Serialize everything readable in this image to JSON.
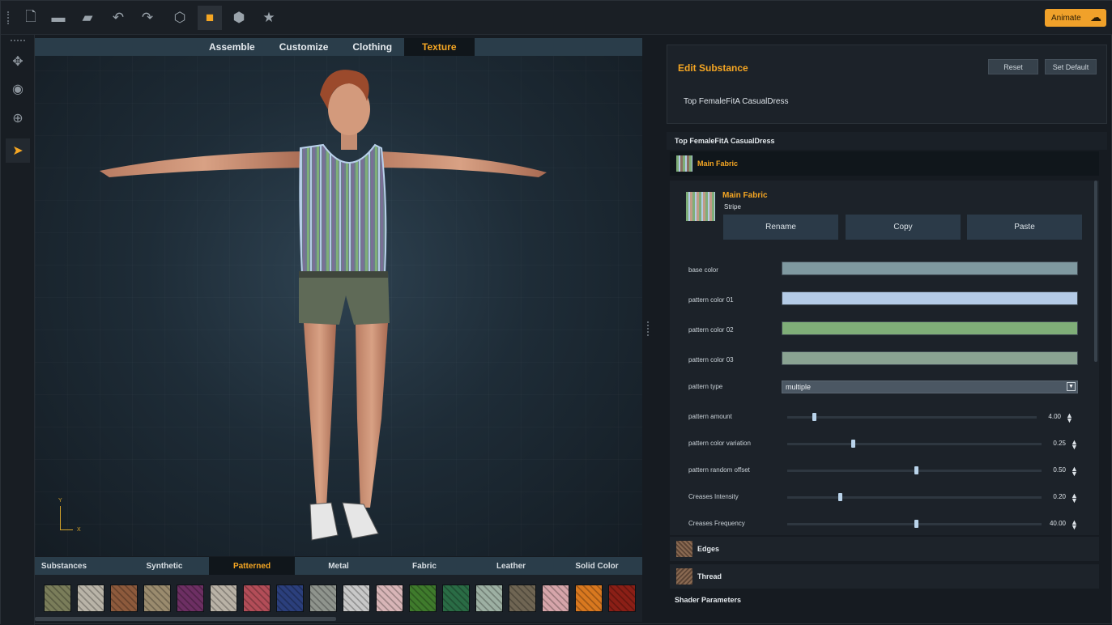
{
  "toolbar": {
    "buttons": [
      "new-file-icon",
      "open-folder-icon",
      "save-icon",
      "undo-icon",
      "redo-icon",
      "cube-wire-icon",
      "cube-solid-icon",
      "cube-shaded-icon",
      "star-icon"
    ],
    "animate_label": "Animate"
  },
  "viewport": {
    "tabs": [
      "Assemble",
      "Customize",
      "Clothing",
      "Texture"
    ],
    "active_tab": "Texture",
    "axis_y": "Y",
    "axis_x": "X"
  },
  "library": {
    "tabs": [
      "Substances",
      "Synthetic",
      "Patterned",
      "Metal",
      "Fabric",
      "Leather",
      "Solid Color"
    ],
    "active_tab": "Patterned",
    "swatch_colors": [
      "#7a7d5a",
      "#b9b4a8",
      "#8d5a3c",
      "#9a8b6e",
      "#6d2f63",
      "#b9b2a6",
      "#b34d58",
      "#2b3f7c",
      "#8f948d",
      "#c8c8c8",
      "#d8b5b7",
      "#3f7b2c",
      "#2a6c45",
      "#9db0a3",
      "#6f6553",
      "#d6a5aa",
      "#d9781f",
      "#8b1f16"
    ]
  },
  "edit": {
    "title": "Edit Substance",
    "reset": "Reset",
    "set_default": "Set Default",
    "item": "Top FemaleFitA CasualDress"
  },
  "object": {
    "name": "Top FemaleFitA CasualDress",
    "sections": [
      "Main Fabric",
      "Edges",
      "Thread"
    ],
    "shader_header": "Shader Parameters"
  },
  "fabric": {
    "title": "Main Fabric",
    "subtitle": "Stripe",
    "rename": "Rename",
    "copy": "Copy",
    "paste": "Paste"
  },
  "properties": {
    "base_color": {
      "label": "base color",
      "color": "#7f99a0"
    },
    "pattern_color_01": {
      "label": "pattern color 01",
      "color": "#b4cbe6"
    },
    "pattern_color_02": {
      "label": "pattern color 02",
      "color": "#7fae78"
    },
    "pattern_color_03": {
      "label": "pattern color 03",
      "color": "#8aa392"
    },
    "pattern_type": {
      "label": "pattern type",
      "value": "multiple"
    },
    "sliders": [
      {
        "label": "pattern amount",
        "value": "4.00",
        "fraction": 0.1
      },
      {
        "label": "pattern color variation",
        "value": "0.25",
        "fraction": 0.25
      },
      {
        "label": "pattern random offset",
        "value": "0.50",
        "fraction": 0.5
      },
      {
        "label": "Creases Intensity",
        "value": "0.20",
        "fraction": 0.2
      },
      {
        "label": "Creases Frequency",
        "value": "40.00",
        "fraction": 0.5
      }
    ]
  }
}
